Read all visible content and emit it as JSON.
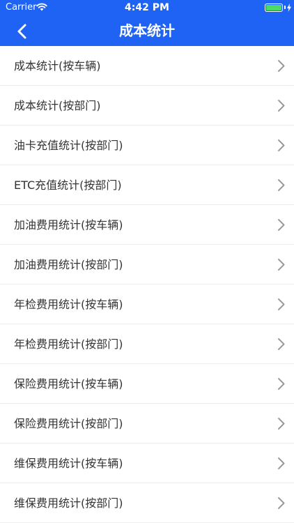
{
  "status": {
    "carrier": "Carrier",
    "time": "4:42 PM",
    "battery_level": 1.0
  },
  "colors": {
    "header_bg": "#1f63f5",
    "battery_fill": "#4cd964",
    "row_text": "#333333",
    "chevron": "#9a9a9a"
  },
  "icons": {
    "back": "chevron-left-icon",
    "row": "chevron-right-icon",
    "wifi": "wifi-icon",
    "battery": "battery-icon",
    "charging": "charging-bolt-icon"
  },
  "nav": {
    "title": "成本统计"
  },
  "list": {
    "items": [
      {
        "label": "成本统计(按车辆)"
      },
      {
        "label": "成本统计(按部门)"
      },
      {
        "label": "油卡充值统计(按部门)"
      },
      {
        "label": "ETC充值统计(按部门)"
      },
      {
        "label": "加油费用统计(按车辆)"
      },
      {
        "label": "加油费用统计(按部门)"
      },
      {
        "label": "年检费用统计(按车辆)"
      },
      {
        "label": "年检费用统计(按部门)"
      },
      {
        "label": "保险费用统计(按车辆)"
      },
      {
        "label": "保险费用统计(按部门)"
      },
      {
        "label": "维保费用统计(按车辆)"
      },
      {
        "label": "维保费用统计(按部门)"
      }
    ]
  }
}
